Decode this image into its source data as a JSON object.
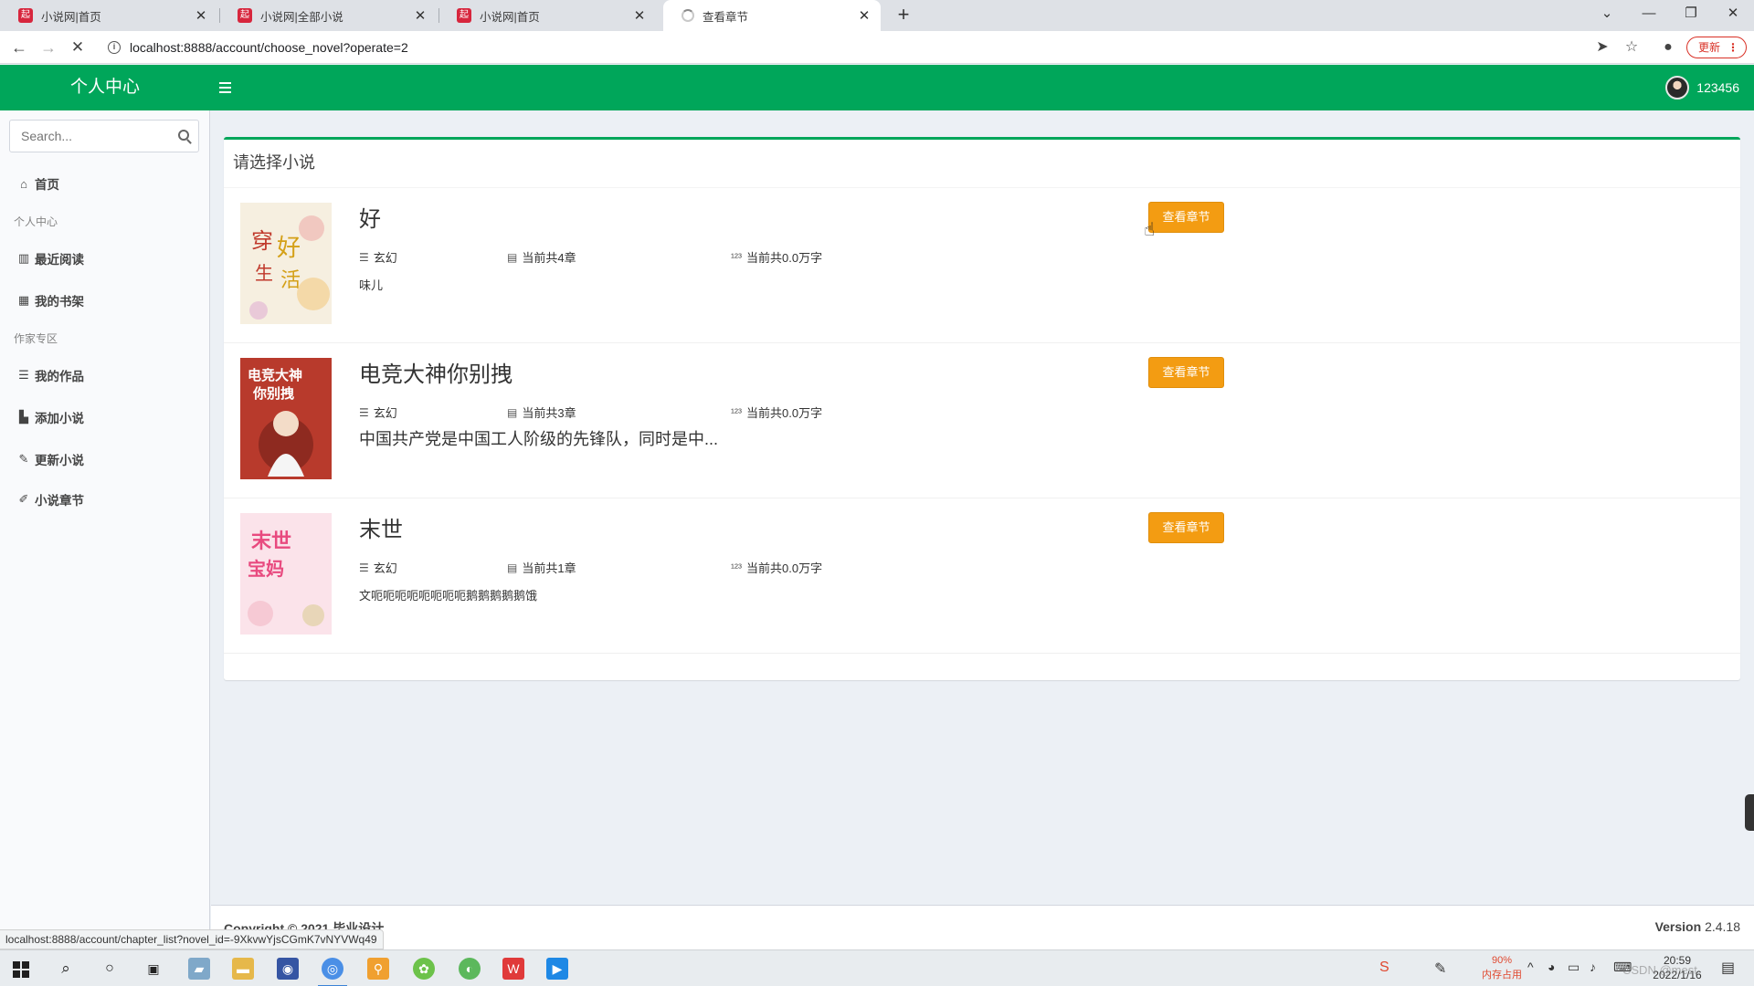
{
  "browser": {
    "tabs": [
      {
        "title": "小说网|首页",
        "favicon": "起"
      },
      {
        "title": "小说网|全部小说",
        "favicon": "起"
      },
      {
        "title": "小说网|首页",
        "favicon": "起"
      },
      {
        "title": "查看章节",
        "favicon": ""
      }
    ],
    "url": "localhost:8888/account/choose_novel?operate=2",
    "update_label": "更新",
    "status_url": "localhost:8888/account/chapter_list?novel_id=-9XkvwYjsCGmK7vNYVWq49"
  },
  "header": {
    "logo": "个人中心",
    "username": "123456"
  },
  "sidebar": {
    "search_placeholder": "Search...",
    "items": [
      {
        "label": "首页",
        "icon": "home-icon"
      },
      {
        "label": "个人中心",
        "type": "header"
      },
      {
        "label": "最近阅读",
        "icon": "book-open-icon"
      },
      {
        "label": "我的书架",
        "icon": "shelf-icon"
      },
      {
        "label": "作家专区",
        "type": "header"
      },
      {
        "label": "我的作品",
        "icon": "list-icon"
      },
      {
        "label": "添加小说",
        "icon": "upload-icon"
      },
      {
        "label": "更新小说",
        "icon": "pencil-icon"
      },
      {
        "label": "小说章节",
        "icon": "edit-icon"
      }
    ]
  },
  "main": {
    "box_title": "请选择小说",
    "button_label": "查看章节",
    "novels": [
      {
        "title": "好",
        "category": "玄幻",
        "chapters": "当前共4章",
        "words": "当前共0.0万字",
        "desc": "味儿",
        "desc_large": false,
        "cover_color": "#f6efe0",
        "cover_text": "穿好生活"
      },
      {
        "title": "电竞大神你别拽",
        "category": "玄幻",
        "chapters": "当前共3章",
        "words": "当前共0.0万字",
        "desc": "中国共产党是中国工人阶级的先锋队，同时是中...",
        "desc_large": true,
        "cover_color": "#b83a2c",
        "cover_text": "电竞大神你别拽"
      },
      {
        "title": "末世",
        "category": "玄幻",
        "chapters": "当前共1章",
        "words": "当前共0.0万字",
        "desc": "文呃呃呃呃呃呃呃呃鹅鹅鹅鹅鹅饿",
        "desc_large": false,
        "cover_color": "#fbe3ea",
        "cover_text": "末世宝妈"
      }
    ]
  },
  "footer": {
    "copyright": "Copyright © 2021 毕业设计",
    "version_label": "Version",
    "version": "2.4.18"
  },
  "taskbar": {
    "mem_percent": "90%",
    "mem_label": "内存占用",
    "time": "20:59",
    "date": "2022/1/16",
    "watermark": "CSDN @mest"
  },
  "colors": {
    "brand_green": "#00a65a",
    "warning_orange": "#f39c12"
  }
}
